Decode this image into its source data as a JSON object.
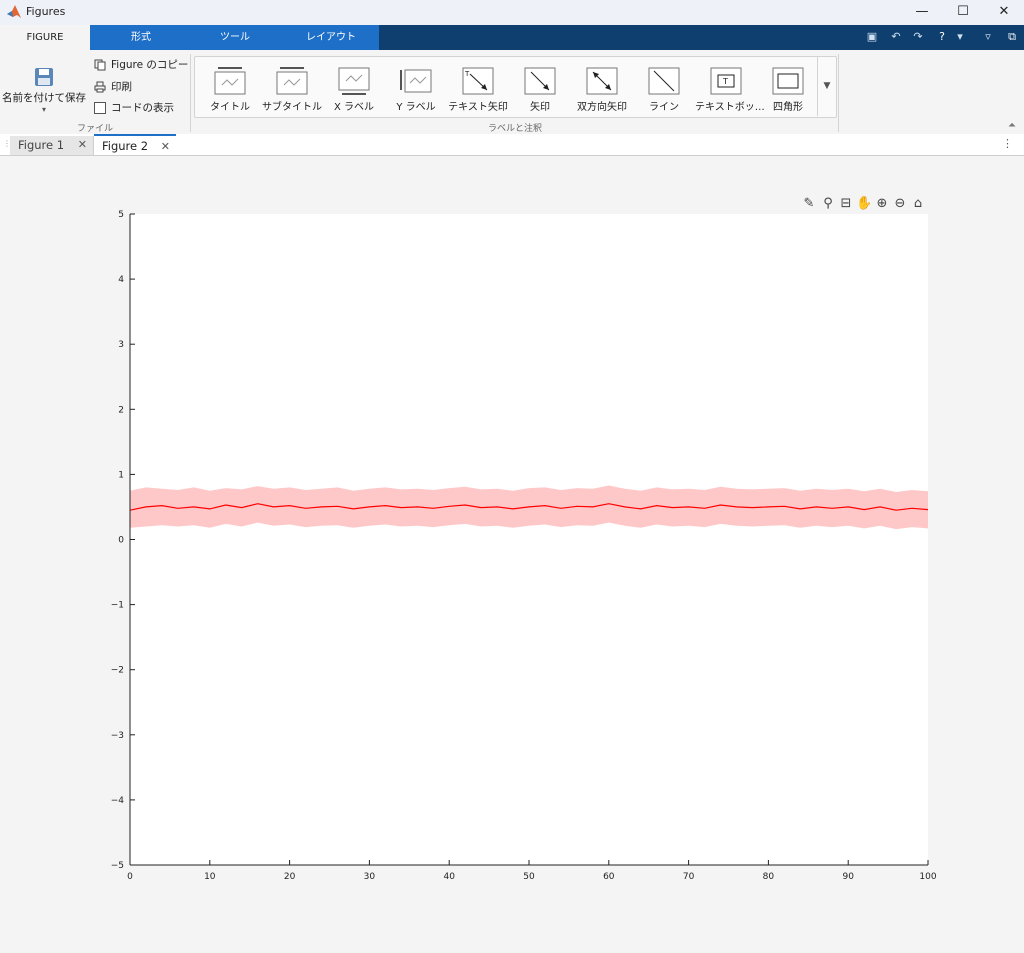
{
  "window": {
    "title": "Figures",
    "minimize": "—",
    "maximize": "☐",
    "close": "✕"
  },
  "toolstrip": {
    "tabs": [
      "FIGURE",
      "形式",
      "ツール",
      "レイアウト"
    ],
    "file_group": {
      "save_as": "名前を付けて保存",
      "copy_figure": "Figure のコピー",
      "print": "印刷",
      "show_code": "コードの表示",
      "label": "ファイル"
    },
    "annotation_group": {
      "items": [
        "タイトル",
        "サブタイトル",
        "X ラベル",
        "Y ラベル",
        "テキスト矢印",
        "矢印",
        "双方向矢印",
        "ライン",
        "テキストボッ…",
        "四角形"
      ],
      "label": "ラベルと注釈"
    }
  },
  "document_tabs": [
    {
      "label": "Figure 1",
      "active": false
    },
    {
      "label": "Figure 2",
      "active": true
    }
  ],
  "axes_toolbar": [
    "brush-icon",
    "data-tip-icon",
    "restore-view-icon",
    "pan-icon",
    "zoom-in-icon",
    "zoom-out-icon",
    "home-icon"
  ],
  "chart_data": {
    "type": "line",
    "title": "",
    "xlabel": "",
    "ylabel": "",
    "xlim": [
      0,
      100
    ],
    "ylim": [
      -5,
      5
    ],
    "xticks": [
      0,
      10,
      20,
      30,
      40,
      50,
      60,
      70,
      80,
      90,
      100
    ],
    "yticks": [
      -5,
      -4,
      -3,
      -2,
      -1,
      0,
      1,
      2,
      3,
      4,
      5
    ],
    "grid": false,
    "legend": "none",
    "series": [
      {
        "style": "line",
        "color": "#ff0000",
        "x": [
          0,
          2,
          4,
          6,
          8,
          10,
          12,
          14,
          16,
          18,
          20,
          22,
          24,
          26,
          28,
          30,
          32,
          34,
          36,
          38,
          40,
          42,
          44,
          46,
          48,
          50,
          52,
          54,
          56,
          58,
          60,
          62,
          64,
          66,
          68,
          70,
          72,
          74,
          76,
          78,
          80,
          82,
          84,
          86,
          88,
          90,
          92,
          94,
          96,
          98,
          100
        ],
        "y": [
          0.45,
          0.5,
          0.52,
          0.48,
          0.5,
          0.47,
          0.53,
          0.49,
          0.55,
          0.5,
          0.52,
          0.48,
          0.5,
          0.51,
          0.47,
          0.5,
          0.52,
          0.49,
          0.5,
          0.48,
          0.51,
          0.53,
          0.49,
          0.5,
          0.47,
          0.5,
          0.52,
          0.48,
          0.51,
          0.5,
          0.55,
          0.5,
          0.47,
          0.52,
          0.49,
          0.5,
          0.48,
          0.53,
          0.5,
          0.49,
          0.5,
          0.51,
          0.47,
          0.5,
          0.48,
          0.5,
          0.46,
          0.5,
          0.45,
          0.48,
          0.46
        ]
      },
      {
        "style": "band",
        "color": "#ffc8c8",
        "x": [
          0,
          2,
          4,
          6,
          8,
          10,
          12,
          14,
          16,
          18,
          20,
          22,
          24,
          26,
          28,
          30,
          32,
          34,
          36,
          38,
          40,
          42,
          44,
          46,
          48,
          50,
          52,
          54,
          56,
          58,
          60,
          62,
          64,
          66,
          68,
          70,
          72,
          74,
          76,
          78,
          80,
          82,
          84,
          86,
          88,
          90,
          92,
          94,
          96,
          98,
          100
        ],
        "upper": [
          0.75,
          0.8,
          0.78,
          0.76,
          0.8,
          0.75,
          0.79,
          0.77,
          0.82,
          0.78,
          0.8,
          0.76,
          0.78,
          0.8,
          0.75,
          0.78,
          0.8,
          0.77,
          0.78,
          0.76,
          0.79,
          0.81,
          0.77,
          0.78,
          0.75,
          0.79,
          0.8,
          0.76,
          0.79,
          0.78,
          0.83,
          0.78,
          0.75,
          0.8,
          0.77,
          0.78,
          0.76,
          0.81,
          0.78,
          0.77,
          0.78,
          0.79,
          0.75,
          0.78,
          0.76,
          0.78,
          0.74,
          0.78,
          0.73,
          0.76,
          0.74
        ],
        "lower": [
          0.18,
          0.2,
          0.22,
          0.2,
          0.22,
          0.18,
          0.24,
          0.2,
          0.26,
          0.21,
          0.23,
          0.19,
          0.21,
          0.22,
          0.18,
          0.21,
          0.23,
          0.2,
          0.21,
          0.19,
          0.22,
          0.24,
          0.2,
          0.21,
          0.18,
          0.21,
          0.23,
          0.19,
          0.22,
          0.21,
          0.26,
          0.21,
          0.18,
          0.23,
          0.2,
          0.21,
          0.19,
          0.24,
          0.21,
          0.2,
          0.21,
          0.22,
          0.18,
          0.21,
          0.19,
          0.21,
          0.17,
          0.21,
          0.16,
          0.19,
          0.17
        ]
      }
    ]
  }
}
